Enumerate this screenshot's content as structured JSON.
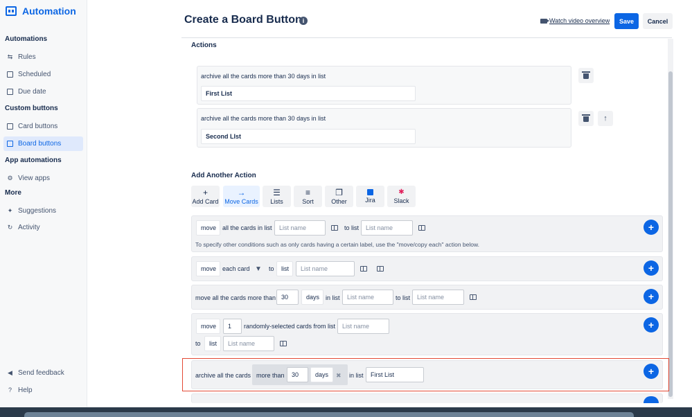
{
  "sidebar": {
    "brand": "Automation",
    "sections": [
      {
        "title": "Automations",
        "items": [
          {
            "label": "Rules"
          },
          {
            "label": "Scheduled"
          },
          {
            "label": "Due date"
          }
        ]
      },
      {
        "title": "Custom buttons",
        "items": [
          {
            "label": "Card buttons"
          },
          {
            "label": "Board buttons"
          }
        ]
      },
      {
        "title": "App automations",
        "items": [
          {
            "label": "View apps"
          }
        ]
      },
      {
        "title": "More",
        "items": [
          {
            "label": "Suggestions"
          },
          {
            "label": "Activity"
          }
        ]
      }
    ],
    "footer": [
      {
        "label": "Send feedback"
      },
      {
        "label": "Help"
      }
    ]
  },
  "header": {
    "title": "Create a Board Button",
    "watch": "Watch video overview",
    "save": "Save",
    "cancel": "Cancel"
  },
  "actions": {
    "heading": "Actions",
    "items": [
      {
        "description": "archive all the cards more than 30 days in list",
        "list": "First List"
      },
      {
        "description": "archive all the cards more than 30 days in list",
        "list": "Second LIst"
      }
    ]
  },
  "add_action": {
    "heading": "Add Another Action",
    "tabs": [
      {
        "label": "Add Card",
        "icon": "+"
      },
      {
        "label": "Move Cards",
        "icon": "→"
      },
      {
        "label": "Lists",
        "icon": "☰"
      },
      {
        "label": "Sort",
        "icon": "≡"
      },
      {
        "label": "Other",
        "icon": "❐"
      },
      {
        "label": "Jira",
        "icon": "jira"
      },
      {
        "label": "Slack",
        "icon": "slack"
      }
    ]
  },
  "rows": {
    "r1": {
      "move": "move",
      "all_cards": "all the cards in list",
      "list_ph": "List name",
      "to_list": "to list",
      "list2_ph": "List name",
      "note": "To specify other conditions such as only cards having a certain label, use the \"move/copy each\" action below."
    },
    "r2": {
      "move": "move",
      "each_card": "each card",
      "to": "to",
      "list": "list",
      "list_ph": "List name"
    },
    "r3": {
      "prefix": "move all the cards more than",
      "days_val": "30",
      "days": "days",
      "in_list": "in list",
      "list_ph": "List name",
      "to_list": "to list",
      "list2_ph": "List name"
    },
    "r4": {
      "move": "move",
      "count": "1",
      "random": "randomly-selected cards from list",
      "list_ph": "List name",
      "to": "to",
      "list": "list",
      "list2_ph": "List name"
    },
    "r5": {
      "prefix": "archive all the cards",
      "more_than": "more than",
      "days_val": "30",
      "days": "days",
      "remove": "✖",
      "in_list": "in list",
      "list_val": "First List"
    }
  },
  "colors": {
    "accent": "#0c66e4",
    "highlight": "#e34935"
  }
}
